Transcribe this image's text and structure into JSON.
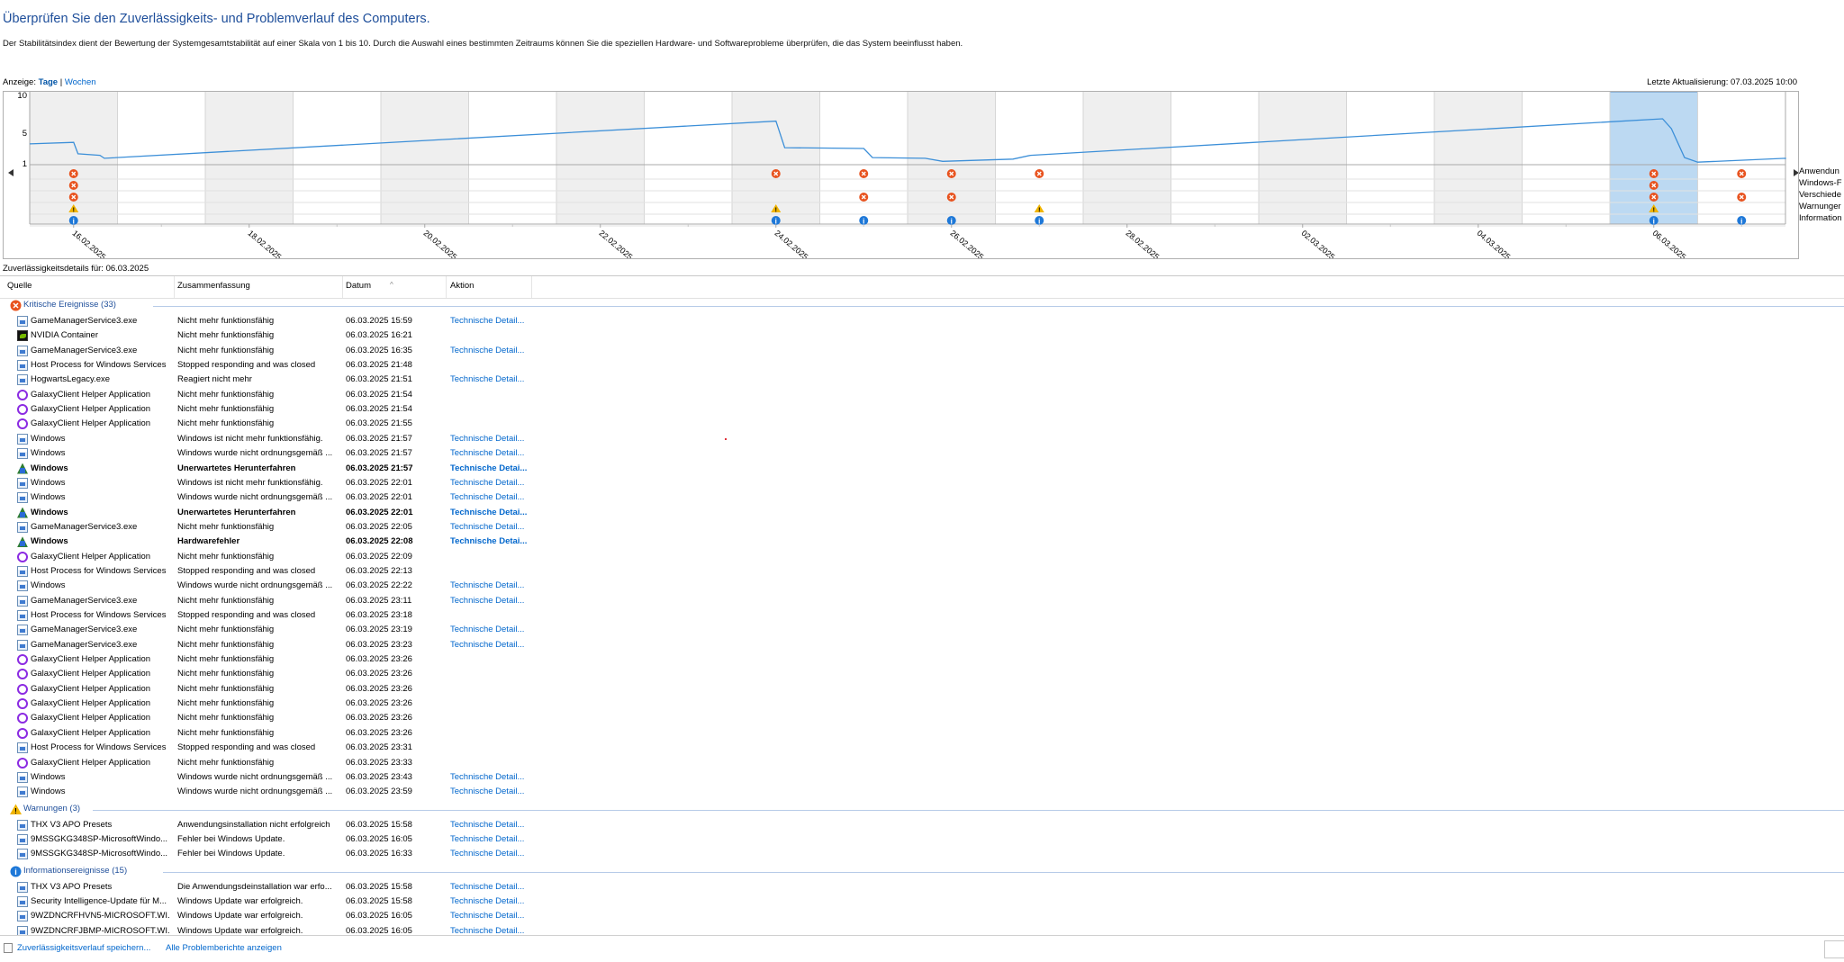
{
  "title": "Überprüfen Sie den Zuverlässigkeits- und Problemverlauf des Computers.",
  "description": "Der Stabilitätsindex dient der Bewertung der Systemgesamtstabilität auf einer Skala von 1 bis 10. Durch die Auswahl eines bestimmten Zeitraums können Sie die speziellen Hardware- und Softwareprobleme überprüfen, die das System beeinflusst haben.",
  "view": {
    "label": "Anzeige:",
    "days": "Tage",
    "sep": "|",
    "weeks": "Wochen"
  },
  "last_update": "Letzte Aktualisierung: 07.03.2025 10:00",
  "chart_categories": [
    "Anwendun",
    "Windows-F",
    "Verschiede",
    "Warnunger",
    "Information"
  ],
  "chart_data": {
    "type": "line",
    "yticks": [
      "10",
      "5",
      "1"
    ],
    "ylim": [
      1,
      10
    ],
    "date_labels": [
      "16.02.2025",
      "18.02.2025",
      "20.02.2025",
      "22.02.2025",
      "24.02.2025",
      "26.02.2025",
      "28.02.2025",
      "02.03.2025",
      "04.03.2025",
      "06.03.2025"
    ],
    "day_count": 20,
    "selected_day": 18,
    "stability": [
      [
        0.0,
        3.5
      ],
      [
        0.5,
        3.7
      ],
      [
        0.55,
        2.2
      ],
      [
        0.8,
        2.0
      ],
      [
        0.85,
        1.6
      ],
      [
        8.5,
        6.5
      ],
      [
        8.6,
        3.0
      ],
      [
        9.5,
        2.9
      ],
      [
        9.6,
        1.7
      ],
      [
        10.2,
        1.6
      ],
      [
        10.4,
        1.2
      ],
      [
        11.2,
        1.5
      ],
      [
        11.4,
        2.0
      ],
      [
        18.6,
        6.8
      ],
      [
        18.7,
        5.5
      ],
      [
        18.85,
        1.7
      ],
      [
        19.0,
        1.1
      ],
      [
        20.0,
        1.6
      ],
      [
        20.0,
        1.5
      ]
    ],
    "markers": {
      "app_failures": [
        0,
        8,
        9,
        10,
        11,
        18,
        19
      ],
      "windows_failures": [
        0,
        18
      ],
      "misc_failures": [
        0,
        9,
        10,
        18,
        19
      ],
      "warnings": [
        0,
        8,
        11,
        18
      ],
      "information": [
        0,
        8,
        9,
        10,
        11,
        18,
        19
      ]
    },
    "colors": {
      "line": "#3c8fd8",
      "selection": "#bcd9f2",
      "shade": "#efefef",
      "error": "#e8531f",
      "warning": "#f0b400",
      "info": "#1e78d8"
    }
  },
  "details_title": "Zuverlässigkeitsdetails für: 06.03.2025",
  "columns": {
    "source": "Quelle",
    "summary": "Zusammenfassung",
    "date": "Datum",
    "action": "Aktion"
  },
  "groups": [
    {
      "name": "Kritische Ereignisse (33)",
      "icon": "error-icon",
      "rows": [
        {
          "icon": "app",
          "source": "GameManagerService3.exe",
          "summary": "Nicht mehr funktionsfähig",
          "date": "06.03.2025 15:59",
          "action": "Technische Detail..."
        },
        {
          "icon": "nvidia",
          "source": "NVIDIA Container",
          "summary": "Nicht mehr funktionsfähig",
          "date": "06.03.2025 16:21",
          "action": ""
        },
        {
          "icon": "app",
          "source": "GameManagerService3.exe",
          "summary": "Nicht mehr funktionsfähig",
          "date": "06.03.2025 16:35",
          "action": "Technische Detail..."
        },
        {
          "icon": "app",
          "source": "Host Process for Windows Services",
          "summary": "Stopped responding and was closed",
          "date": "06.03.2025 21:48",
          "action": ""
        },
        {
          "icon": "app",
          "source": "HogwartsLegacy.exe",
          "summary": "Reagiert nicht mehr",
          "date": "06.03.2025 21:51",
          "action": "Technische Detail..."
        },
        {
          "icon": "galaxy",
          "source": "GalaxyClient Helper Application",
          "summary": "Nicht mehr funktionsfähig",
          "date": "06.03.2025 21:54",
          "action": ""
        },
        {
          "icon": "galaxy",
          "source": "GalaxyClient Helper Application",
          "summary": "Nicht mehr funktionsfähig",
          "date": "06.03.2025 21:54",
          "action": ""
        },
        {
          "icon": "galaxy",
          "source": "GalaxyClient Helper Application",
          "summary": "Nicht mehr funktionsfähig",
          "date": "06.03.2025 21:55",
          "action": ""
        },
        {
          "icon": "app",
          "source": "Windows",
          "summary": "Windows ist nicht mehr funktionsfähig.",
          "date": "06.03.2025 21:57",
          "action": "Technische Detail..."
        },
        {
          "icon": "app",
          "source": "Windows",
          "summary": "Windows wurde nicht ordnungsgemäß ...",
          "date": "06.03.2025 21:57",
          "action": "Technische Detail..."
        },
        {
          "icon": "win",
          "source": "Windows",
          "summary": "Unerwartetes Herunterfahren",
          "date": "06.03.2025 21:57",
          "action": "Technische Detai...",
          "bold": true
        },
        {
          "icon": "app",
          "source": "Windows",
          "summary": "Windows ist nicht mehr funktionsfähig.",
          "date": "06.03.2025 22:01",
          "action": "Technische Detail..."
        },
        {
          "icon": "app",
          "source": "Windows",
          "summary": "Windows wurde nicht ordnungsgemäß ...",
          "date": "06.03.2025 22:01",
          "action": "Technische Detail..."
        },
        {
          "icon": "win",
          "source": "Windows",
          "summary": "Unerwartetes Herunterfahren",
          "date": "06.03.2025 22:01",
          "action": "Technische Detai...",
          "bold": true
        },
        {
          "icon": "app",
          "source": "GameManagerService3.exe",
          "summary": "Nicht mehr funktionsfähig",
          "date": "06.03.2025 22:05",
          "action": "Technische Detail..."
        },
        {
          "icon": "win",
          "source": "Windows",
          "summary": "Hardwarefehler",
          "date": "06.03.2025 22:08",
          "action": "Technische Detai...",
          "bold": true
        },
        {
          "icon": "galaxy",
          "source": "GalaxyClient Helper Application",
          "summary": "Nicht mehr funktionsfähig",
          "date": "06.03.2025 22:09",
          "action": ""
        },
        {
          "icon": "app",
          "source": "Host Process for Windows Services",
          "summary": "Stopped responding and was closed",
          "date": "06.03.2025 22:13",
          "action": ""
        },
        {
          "icon": "app",
          "source": "Windows",
          "summary": "Windows wurde nicht ordnungsgemäß ...",
          "date": "06.03.2025 22:22",
          "action": "Technische Detail..."
        },
        {
          "icon": "app",
          "source": "GameManagerService3.exe",
          "summary": "Nicht mehr funktionsfähig",
          "date": "06.03.2025 23:11",
          "action": "Technische Detail..."
        },
        {
          "icon": "app",
          "source": "Host Process for Windows Services",
          "summary": "Stopped responding and was closed",
          "date": "06.03.2025 23:18",
          "action": ""
        },
        {
          "icon": "app",
          "source": "GameManagerService3.exe",
          "summary": "Nicht mehr funktionsfähig",
          "date": "06.03.2025 23:19",
          "action": "Technische Detail..."
        },
        {
          "icon": "app",
          "source": "GameManagerService3.exe",
          "summary": "Nicht mehr funktionsfähig",
          "date": "06.03.2025 23:23",
          "action": "Technische Detail..."
        },
        {
          "icon": "galaxy",
          "source": "GalaxyClient Helper Application",
          "summary": "Nicht mehr funktionsfähig",
          "date": "06.03.2025 23:26",
          "action": ""
        },
        {
          "icon": "galaxy",
          "source": "GalaxyClient Helper Application",
          "summary": "Nicht mehr funktionsfähig",
          "date": "06.03.2025 23:26",
          "action": ""
        },
        {
          "icon": "galaxy",
          "source": "GalaxyClient Helper Application",
          "summary": "Nicht mehr funktionsfähig",
          "date": "06.03.2025 23:26",
          "action": ""
        },
        {
          "icon": "galaxy",
          "source": "GalaxyClient Helper Application",
          "summary": "Nicht mehr funktionsfähig",
          "date": "06.03.2025 23:26",
          "action": ""
        },
        {
          "icon": "galaxy",
          "source": "GalaxyClient Helper Application",
          "summary": "Nicht mehr funktionsfähig",
          "date": "06.03.2025 23:26",
          "action": ""
        },
        {
          "icon": "galaxy",
          "source": "GalaxyClient Helper Application",
          "summary": "Nicht mehr funktionsfähig",
          "date": "06.03.2025 23:26",
          "action": ""
        },
        {
          "icon": "app",
          "source": "Host Process for Windows Services",
          "summary": "Stopped responding and was closed",
          "date": "06.03.2025 23:31",
          "action": ""
        },
        {
          "icon": "galaxy",
          "source": "GalaxyClient Helper Application",
          "summary": "Nicht mehr funktionsfähig",
          "date": "06.03.2025 23:33",
          "action": ""
        },
        {
          "icon": "app",
          "source": "Windows",
          "summary": "Windows wurde nicht ordnungsgemäß ...",
          "date": "06.03.2025 23:43",
          "action": "Technische Detail..."
        },
        {
          "icon": "app",
          "source": "Windows",
          "summary": "Windows wurde nicht ordnungsgemäß ...",
          "date": "06.03.2025 23:59",
          "action": "Technische Detail..."
        }
      ]
    },
    {
      "name": "Warnungen (3)",
      "icon": "warning-icon",
      "rows": [
        {
          "icon": "app",
          "source": "THX V3 APO Presets",
          "summary": "Anwendungsinstallation nicht erfolgreich",
          "date": "06.03.2025 15:58",
          "action": "Technische Detail..."
        },
        {
          "icon": "app",
          "source": "9MSSGKG348SP-MicrosoftWindo...",
          "summary": "Fehler bei Windows Update.",
          "date": "06.03.2025 16:05",
          "action": "Technische Detail..."
        },
        {
          "icon": "app",
          "source": "9MSSGKG348SP-MicrosoftWindo...",
          "summary": "Fehler bei Windows Update.",
          "date": "06.03.2025 16:33",
          "action": "Technische Detail..."
        }
      ]
    },
    {
      "name": "Informationsereignisse (15)",
      "icon": "info-icon",
      "rows": [
        {
          "icon": "app",
          "source": "THX V3 APO Presets",
          "summary": "Die Anwendungsdeinstallation war erfo...",
          "date": "06.03.2025 15:58",
          "action": "Technische Detail..."
        },
        {
          "icon": "app",
          "source": "Security Intelligence-Update für M...",
          "summary": "Windows Update war erfolgreich.",
          "date": "06.03.2025 15:58",
          "action": "Technische Detail..."
        },
        {
          "icon": "app",
          "source": "9WZDNCRFHVN5-MICROSOFT.WI...",
          "summary": "Windows Update war erfolgreich.",
          "date": "06.03.2025 16:05",
          "action": "Technische Detail..."
        },
        {
          "icon": "app",
          "source": "9WZDNCRFJBMP-MICROSOFT.WI...",
          "summary": "Windows Update war erfolgreich.",
          "date": "06.03.2025 16:05",
          "action": "Technische Detail..."
        }
      ]
    }
  ],
  "footer": {
    "save_history": "Zuverlässigkeitsverlauf speichern...",
    "all_reports": "Alle Problemberichte anzeigen"
  }
}
